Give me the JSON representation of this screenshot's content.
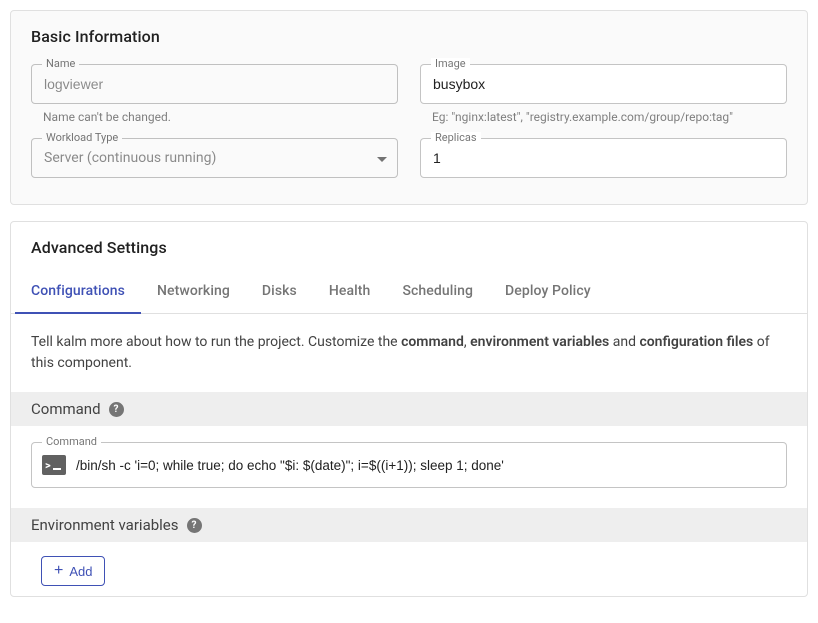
{
  "basic": {
    "title": "Basic Information",
    "name": {
      "label": "Name",
      "value": "logviewer",
      "helper": "Name can't be changed."
    },
    "image": {
      "label": "Image",
      "value": "busybox",
      "helper": "Eg: \"nginx:latest\", \"registry.example.com/group/repo:tag\""
    },
    "workloadType": {
      "label": "Workload Type",
      "value": "Server (continuous running)"
    },
    "replicas": {
      "label": "Replicas",
      "value": "1"
    }
  },
  "advanced": {
    "title": "Advanced Settings",
    "tabs": [
      "Configurations",
      "Networking",
      "Disks",
      "Health",
      "Scheduling",
      "Deploy Policy"
    ],
    "description": {
      "pre": "Tell kalm more about how to run the project. Customize the ",
      "b1": "command",
      "mid1": ", ",
      "b2": "environment variables",
      "mid2": " and ",
      "b3": "configuration files",
      "post": " of this component."
    },
    "command": {
      "header": "Command",
      "label": "Command",
      "value": "/bin/sh -c 'i=0; while true; do echo \"$i: $(date)\"; i=$((i+1)); sleep 1; done'"
    },
    "env": {
      "header": "Environment variables",
      "addLabel": "Add"
    }
  }
}
